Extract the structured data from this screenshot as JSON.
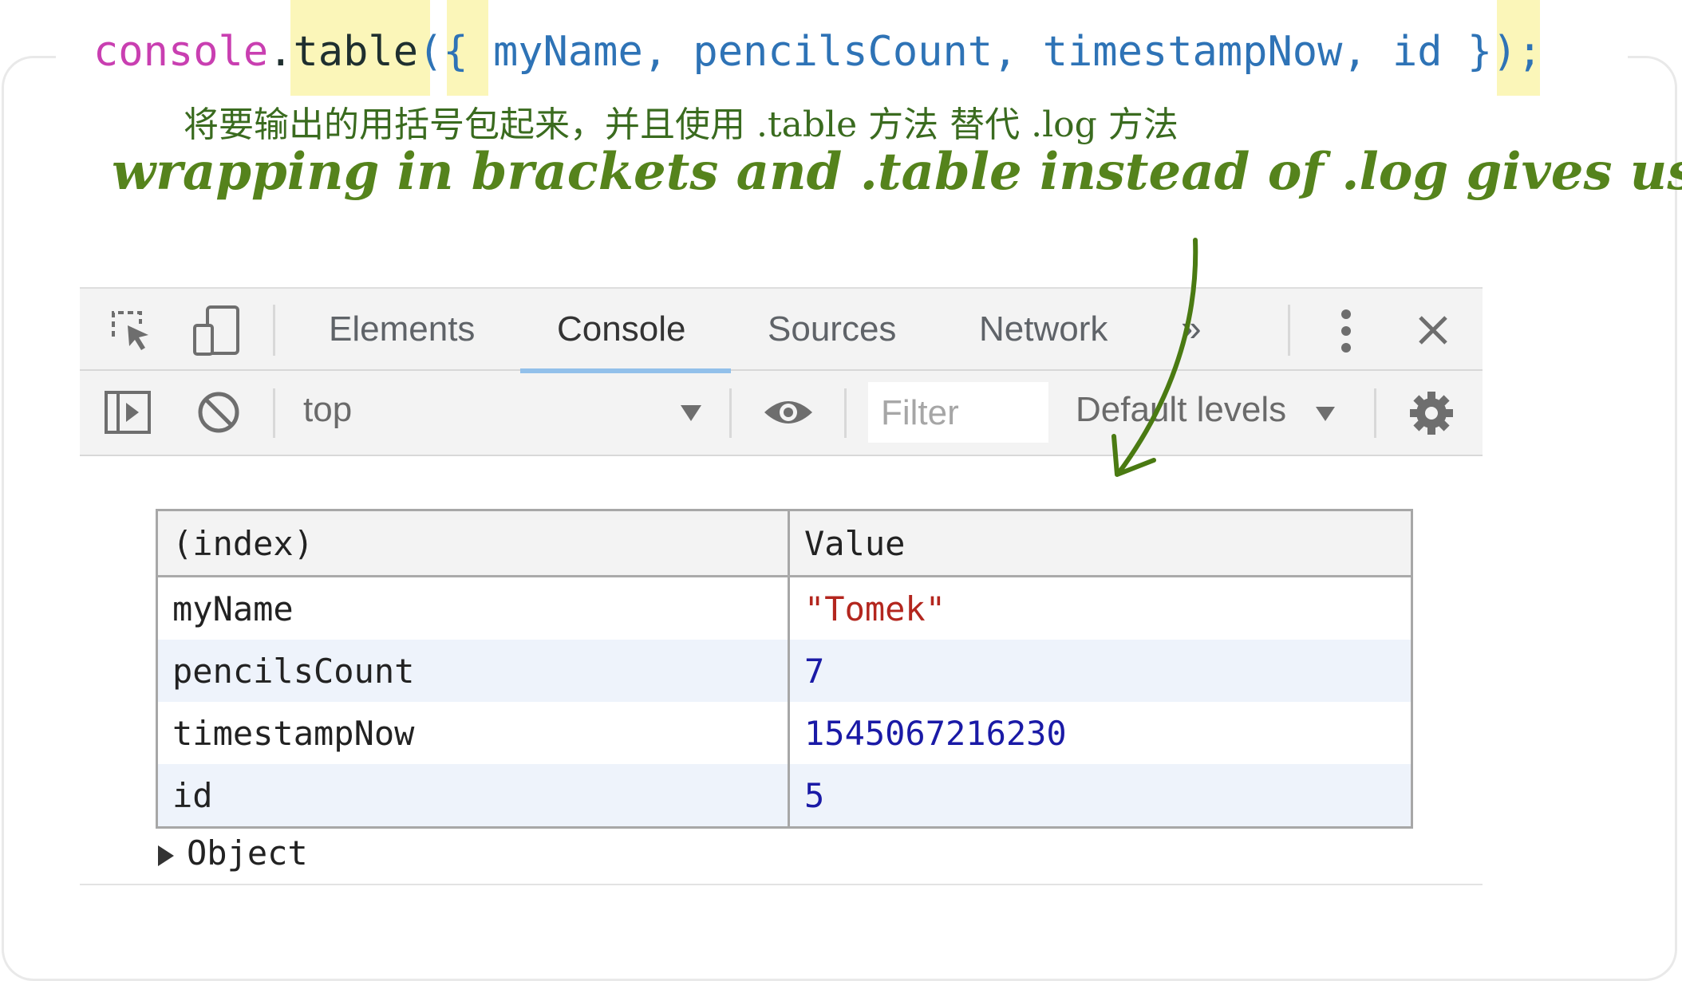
{
  "code": {
    "tokens": [
      "console",
      ".",
      "table",
      "(",
      "{",
      " myName, pencilsCount, timestampNow, id ",
      "}",
      ");"
    ]
  },
  "annotation": {
    "chinese": "将要输出的用括号包起来，并且使用 .table 方法 替代 .log 方法",
    "english": "wrapping in brackets and .table instead of .log gives us:"
  },
  "devtools": {
    "tabs": [
      "Elements",
      "Console",
      "Sources",
      "Network",
      "»"
    ],
    "active_tab": "Console",
    "context": "top",
    "filter_placeholder": "Filter",
    "levels": "Default levels"
  },
  "table": {
    "headers": [
      "(index)",
      "Value"
    ],
    "rows": [
      {
        "index": "myName",
        "value": "\"Tomek\""
      },
      {
        "index": "pencilsCount",
        "value": "7"
      },
      {
        "index": "timestampNow",
        "value": "1545067216230"
      },
      {
        "index": "id",
        "value": "5"
      }
    ],
    "footer": "Object"
  },
  "colors": {
    "accent_underline": "#92c0ea",
    "string_value": "#b3261e",
    "number_value": "#1a1aa6",
    "annotation_green": "#55831c",
    "highlight": "#fbf6b9"
  },
  "icons": [
    "inspect-element-icon",
    "device-toolbar-icon",
    "more-tabs-icon",
    "kebab-menu-icon",
    "close-icon",
    "sidebar-toggle-icon",
    "clear-console-icon",
    "dropdown-arrow-icon",
    "eye-icon",
    "settings-gear-icon"
  ]
}
